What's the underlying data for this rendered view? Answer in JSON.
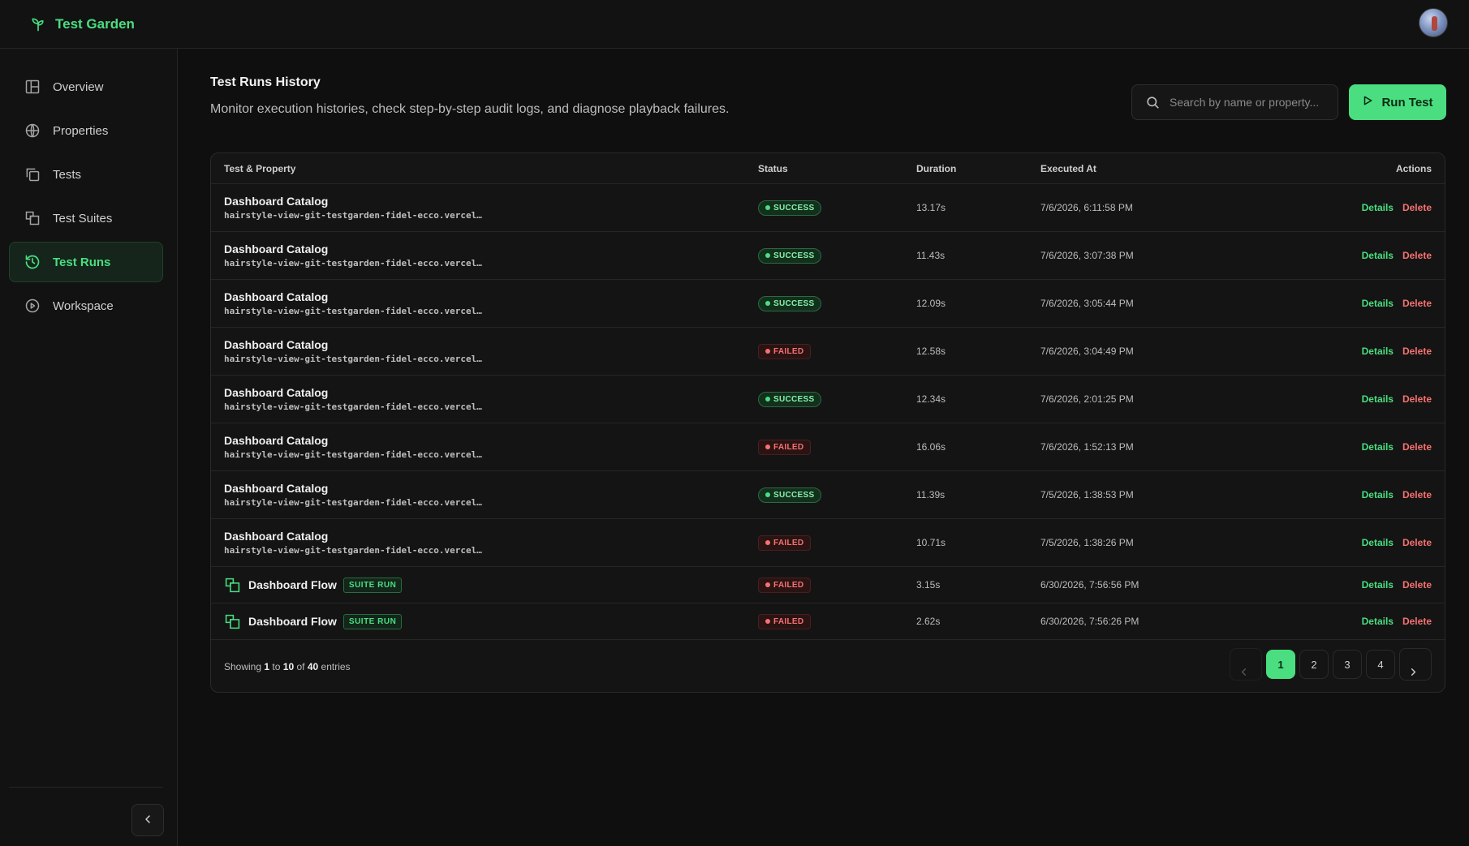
{
  "app": {
    "name": "Test Garden",
    "accent": "#4ade80"
  },
  "sidebar": {
    "items": [
      {
        "label": "Overview",
        "icon": "layout-icon",
        "active": false
      },
      {
        "label": "Properties",
        "icon": "globe-icon",
        "active": false
      },
      {
        "label": "Tests",
        "icon": "copy-icon",
        "active": false
      },
      {
        "label": "Test Suites",
        "icon": "suite-icon",
        "active": false
      },
      {
        "label": "Test Runs",
        "icon": "history-icon",
        "active": true
      },
      {
        "label": "Workspace",
        "icon": "play-circle-icon",
        "active": false
      }
    ]
  },
  "header": {
    "title": "Test Runs History",
    "description": "Monitor execution histories, check step-by-step audit logs, and diagnose playback failures.",
    "search_placeholder": "Search by name or property...",
    "run_label": "Run Test"
  },
  "table": {
    "columns": {
      "test": "Test & Property",
      "status": "Status",
      "duration": "Duration",
      "executed": "Executed At",
      "actions": "Actions"
    },
    "details_label": "Details",
    "delete_label": "Delete",
    "suite_tag": "SUITE RUN",
    "rows": [
      {
        "name": "Dashboard Catalog",
        "url": "hairstyle-view-git-testgarden-fidel-ecco.vercel…",
        "status": "SUCCESS",
        "duration": "13.17s",
        "executed": "7/6/2026, 6:11:58 PM",
        "suite": false
      },
      {
        "name": "Dashboard Catalog",
        "url": "hairstyle-view-git-testgarden-fidel-ecco.vercel…",
        "status": "SUCCESS",
        "duration": "11.43s",
        "executed": "7/6/2026, 3:07:38 PM",
        "suite": false
      },
      {
        "name": "Dashboard Catalog",
        "url": "hairstyle-view-git-testgarden-fidel-ecco.vercel…",
        "status": "SUCCESS",
        "duration": "12.09s",
        "executed": "7/6/2026, 3:05:44 PM",
        "suite": false
      },
      {
        "name": "Dashboard Catalog",
        "url": "hairstyle-view-git-testgarden-fidel-ecco.vercel…",
        "status": "FAILED",
        "duration": "12.58s",
        "executed": "7/6/2026, 3:04:49 PM",
        "suite": false
      },
      {
        "name": "Dashboard Catalog",
        "url": "hairstyle-view-git-testgarden-fidel-ecco.vercel…",
        "status": "SUCCESS",
        "duration": "12.34s",
        "executed": "7/6/2026, 2:01:25 PM",
        "suite": false
      },
      {
        "name": "Dashboard Catalog",
        "url": "hairstyle-view-git-testgarden-fidel-ecco.vercel…",
        "status": "FAILED",
        "duration": "16.06s",
        "executed": "7/6/2026, 1:52:13 PM",
        "suite": false
      },
      {
        "name": "Dashboard Catalog",
        "url": "hairstyle-view-git-testgarden-fidel-ecco.vercel…",
        "status": "SUCCESS",
        "duration": "11.39s",
        "executed": "7/5/2026, 1:38:53 PM",
        "suite": false
      },
      {
        "name": "Dashboard Catalog",
        "url": "hairstyle-view-git-testgarden-fidel-ecco.vercel…",
        "status": "FAILED",
        "duration": "10.71s",
        "executed": "7/5/2026, 1:38:26 PM",
        "suite": false
      },
      {
        "name": "Dashboard Flow",
        "url": "",
        "status": "FAILED",
        "duration": "3.15s",
        "executed": "6/30/2026, 7:56:56 PM",
        "suite": true
      },
      {
        "name": "Dashboard Flow",
        "url": "",
        "status": "FAILED",
        "duration": "2.62s",
        "executed": "6/30/2026, 7:56:26 PM",
        "suite": true
      }
    ]
  },
  "footer": {
    "showing_prefix": "Showing",
    "from": "1",
    "to_word": "to",
    "to": "10",
    "of_word": "of",
    "total": "40",
    "suffix": "entries",
    "pages": [
      "1",
      "2",
      "3",
      "4"
    ],
    "current_page": "1"
  }
}
